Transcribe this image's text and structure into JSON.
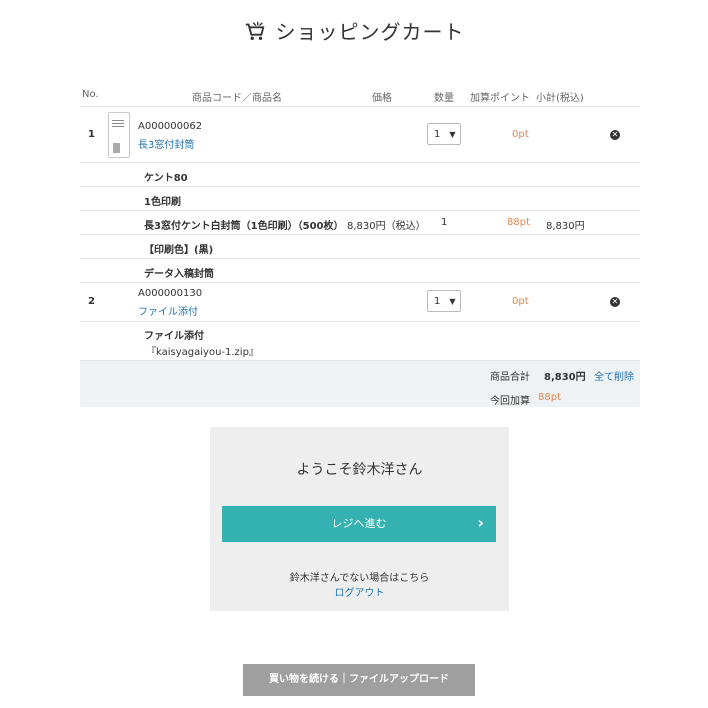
{
  "page": {
    "title": "ショッピングカート"
  },
  "table": {
    "headers": {
      "no": "No.",
      "product": "商品コード／商品名",
      "price": "価格",
      "qty": "数量",
      "points": "加算ポイント",
      "subtotal": "小計(税込)"
    },
    "items": [
      {
        "no": "1",
        "code": "A000000062",
        "name": "長3窓付封筒",
        "qty": "1",
        "points": "0pt",
        "options": [
          "ケント80",
          "1色印刷"
        ],
        "detail": {
          "name": "長3窓付ケント白封筒（1色印刷）（500枚）",
          "price": "8,830円（税込）",
          "qty": "1",
          "points": "88pt",
          "subtotal": "8,830円"
        },
        "extra_options": [
          "【印刷色】(黒)",
          "データ入稿封筒"
        ]
      },
      {
        "no": "2",
        "code": "A000000130",
        "name": "ファイル添付",
        "qty": "1",
        "points": "0pt",
        "attachment_label": "ファイル添付",
        "attachment_file": "『kaisyagaiyou-1.zip』"
      }
    ]
  },
  "summary": {
    "total_label": "商品合計",
    "total_value": "8,830円",
    "delete_all": "全て削除",
    "points_label": "今回加算",
    "points_value": "88pt"
  },
  "login": {
    "welcome": "ようこそ鈴木洋さん",
    "checkout_label": "レジへ進む",
    "not_you": "鈴木洋さんでない場合はこちら",
    "logout": "ログアウト"
  },
  "footer": {
    "continue_label": "買い物を続ける｜ファイルアップロード"
  },
  "colors": {
    "accent": "#34b1b1",
    "link": "#1f72b0",
    "points": "#e08850",
    "summary_bg": "#eef2f5",
    "login_bg": "#eeeeee",
    "continue_bg": "#9f9f9f"
  }
}
